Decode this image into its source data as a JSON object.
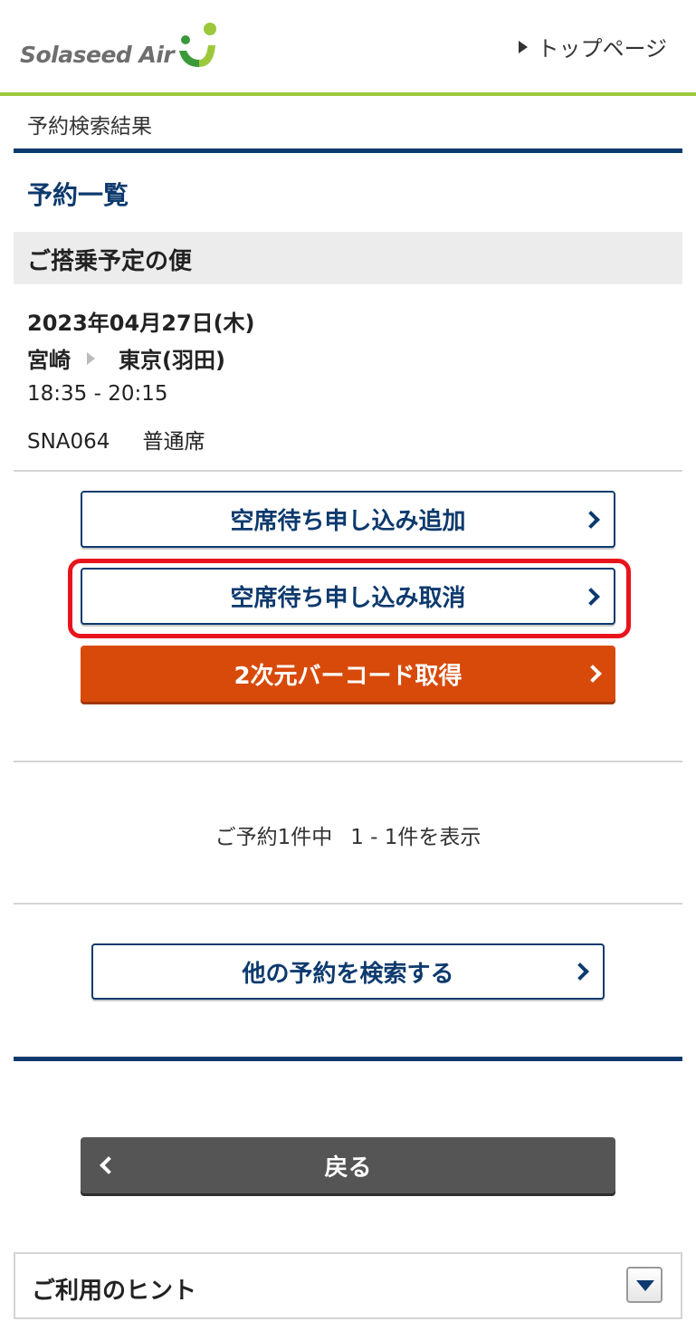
{
  "header": {
    "brand": "Solaseed Air",
    "top_link": "トップページ",
    "brand_colors": {
      "green": "#9cc83c",
      "navy": "#0d3a6e"
    }
  },
  "breadcrumb": "予約検索結果",
  "section_title": "予約一覧",
  "upcoming_heading": "ご搭乗予定の便",
  "flight": {
    "date": "2023年04月27日(木)",
    "origin": "宮崎",
    "destination": "東京(羽田)",
    "time": "18:35 - 20:15",
    "flight_number": "SNA064",
    "seat_class": "普通席"
  },
  "actions": {
    "add_waitlist": "空席待ち申し込み追加",
    "cancel_waitlist": "空席待ち申し込み取消",
    "barcode": "2次元バーコード取得"
  },
  "pagination": {
    "total": "ご予約1件中",
    "range": "1 - 1件を表示"
  },
  "search_other": "他の予約を検索する",
  "back": "戻る",
  "hint_title": "ご利用のヒント",
  "icons": [
    "chevron-right-icon",
    "chevron-left-icon",
    "triangle-right-icon",
    "dropdown-toggle-icon",
    "logo-mark-icon"
  ],
  "colors": {
    "orange_button": "#d84a0a",
    "highlight_red": "#e8141c",
    "back_button": "#555555"
  }
}
